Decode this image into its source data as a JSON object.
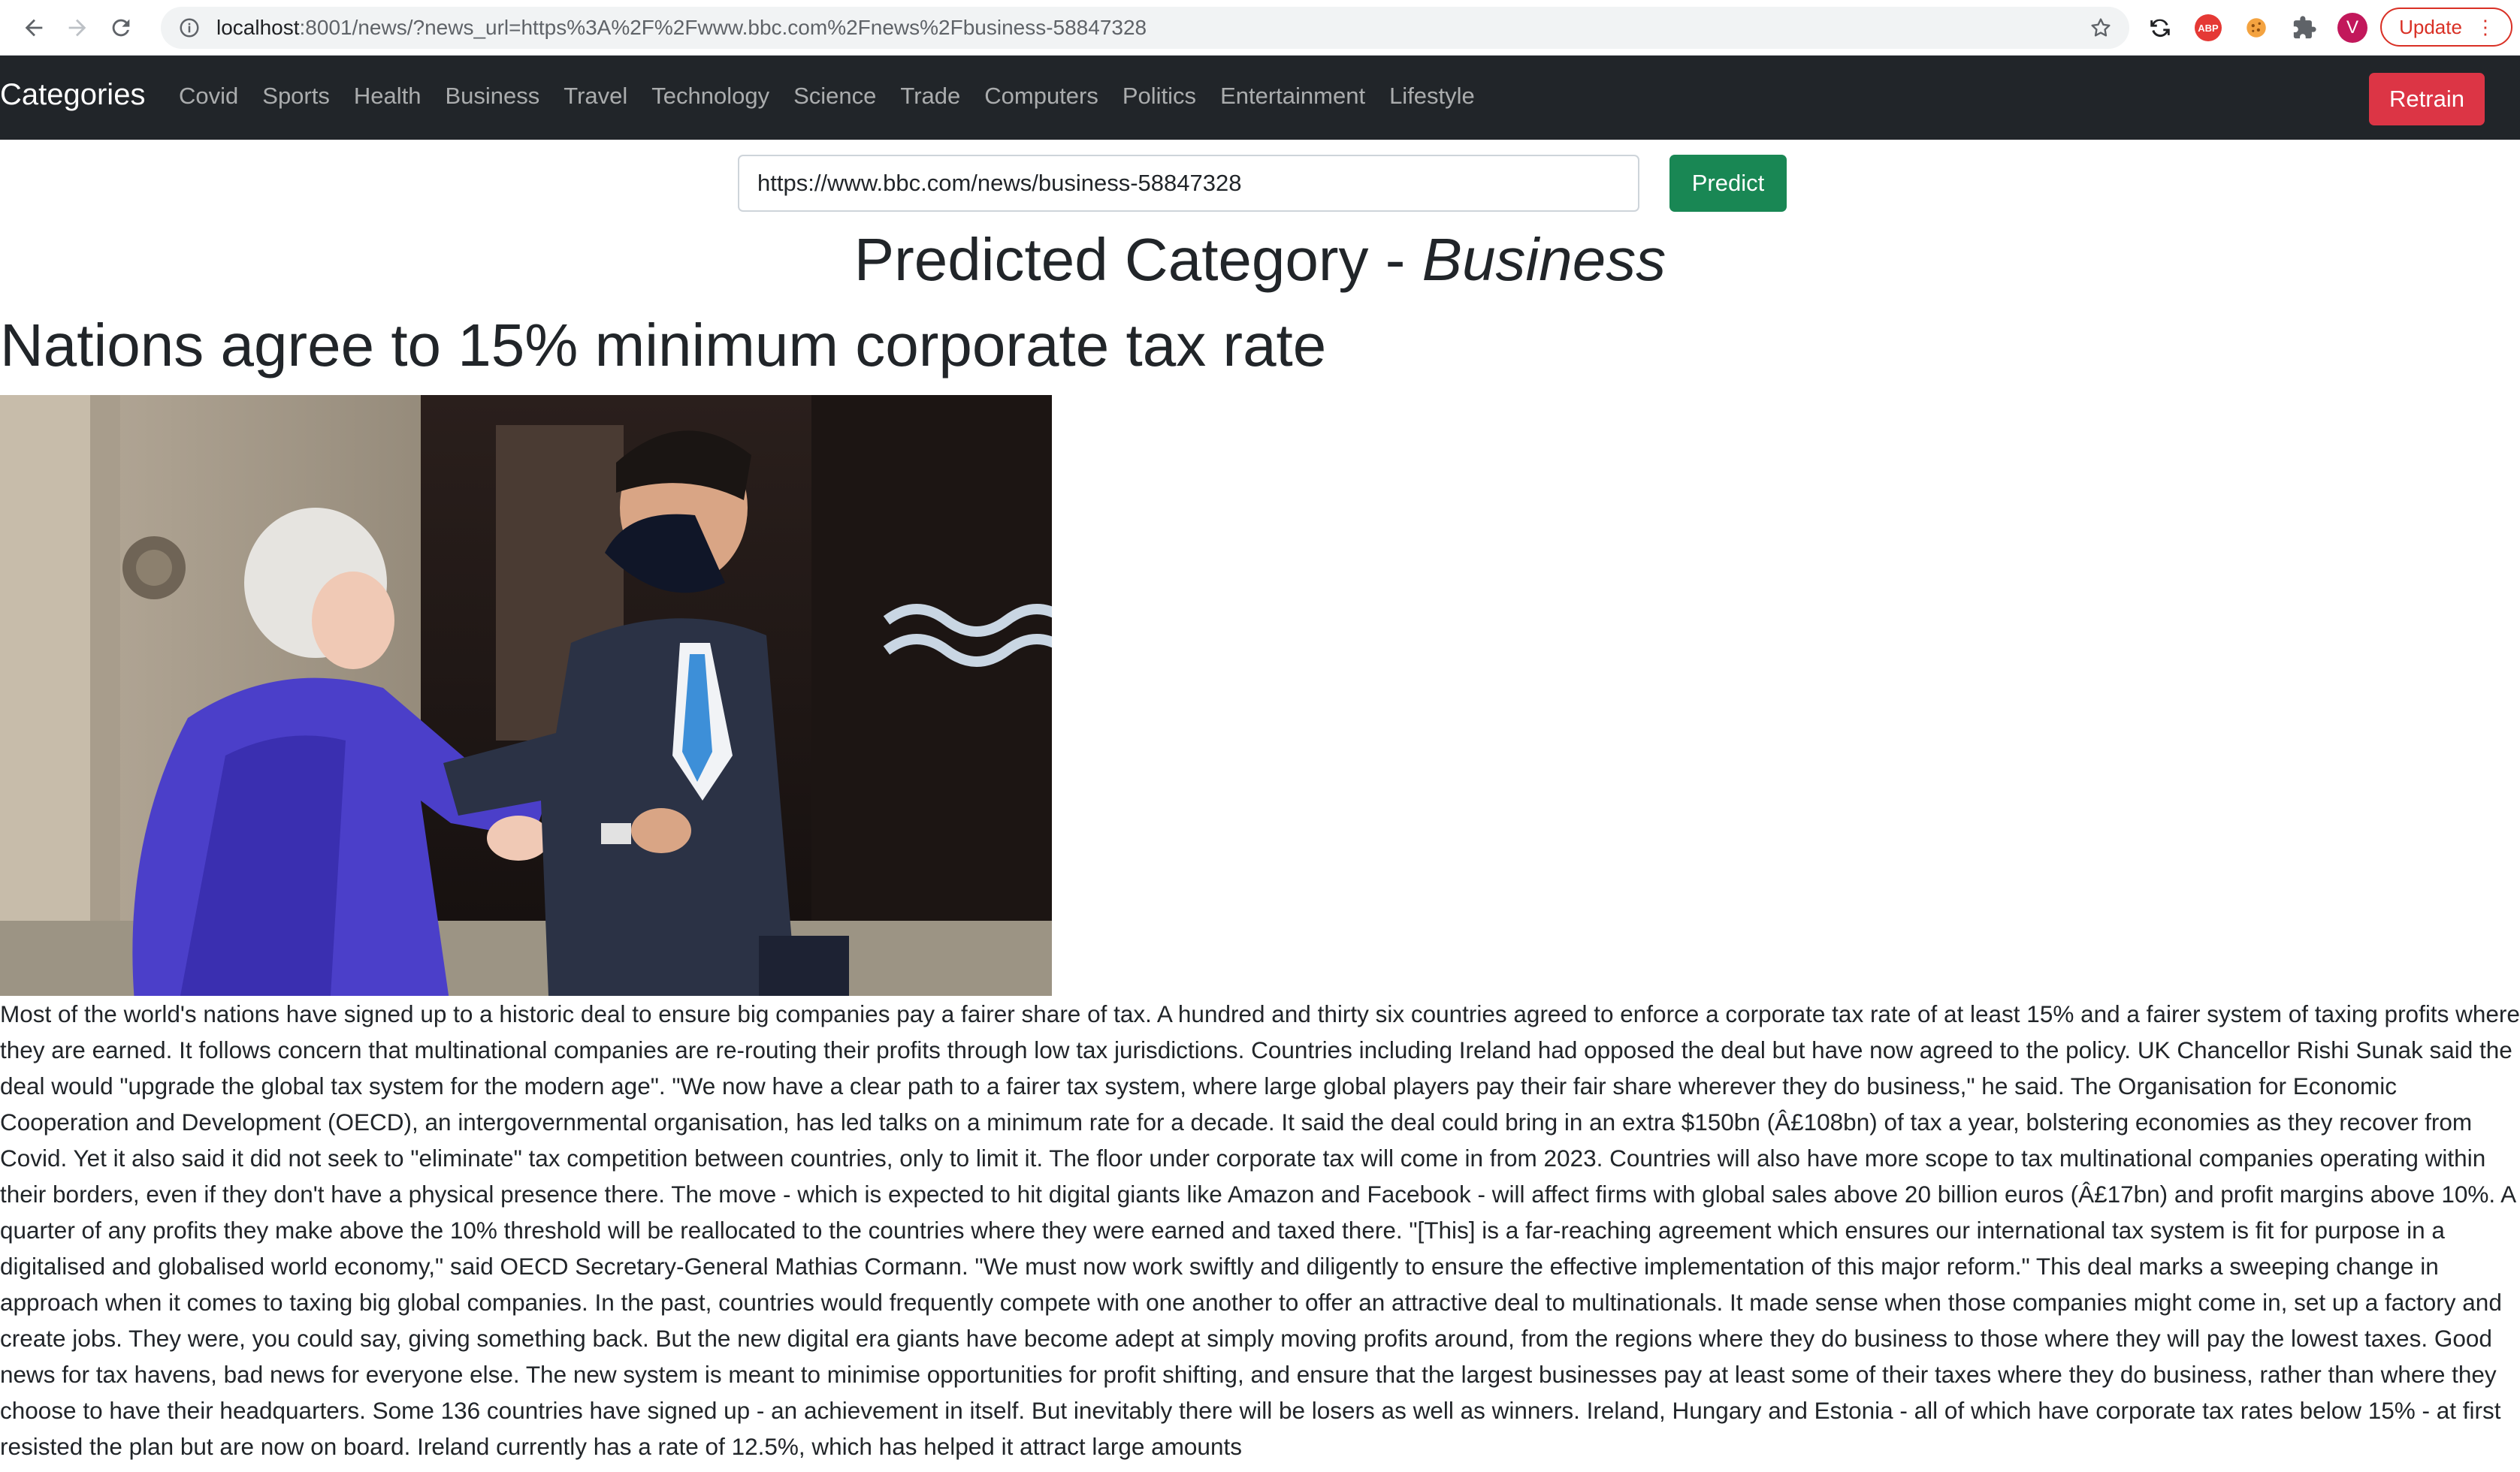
{
  "browser": {
    "url_host": "localhost",
    "url_rest": ":8001/news/?news_url=https%3A%2F%2Fwww.bbc.com%2Fnews%2Fbusiness-58847328",
    "avatar_letter": "V",
    "abp_label": "ABP",
    "update_label": "Update",
    "icons": [
      "back-arrow-icon",
      "forward-arrow-icon",
      "reload-icon",
      "info-icon",
      "star-icon",
      "sync-icon",
      "adblock-icon",
      "cookie-icon",
      "puzzle-icon",
      "kebab-menu-icon"
    ]
  },
  "navbar": {
    "brand": "Categories",
    "links": [
      "Covid",
      "Sports",
      "Health",
      "Business",
      "Travel",
      "Technology",
      "Science",
      "Trade",
      "Computers",
      "Politics",
      "Entertainment",
      "Lifestyle"
    ],
    "retrain_label": "Retrain"
  },
  "form": {
    "url_value": "https://www.bbc.com/news/business-58847328",
    "predict_label": "Predict"
  },
  "prediction": {
    "prefix": "Predicted Category - ",
    "category": "Business"
  },
  "article": {
    "title": "Nations agree to 15% minimum corporate tax rate",
    "body": "Most of the world's nations have signed up to a historic deal to ensure big companies pay a fairer share of tax. A hundred and thirty six countries agreed to enforce a corporate tax rate of at least 15% and a fairer system of taxing profits where they are earned. It follows concern that multinational companies are re-routing their profits through low tax jurisdictions. Countries including Ireland had opposed the deal but have now agreed to the policy. UK Chancellor Rishi Sunak said the deal would \"upgrade the global tax system for the modern age\". \"We now have a clear path to a fairer tax system, where large global players pay their fair share wherever they do business,\" he said. The Organisation for Economic Cooperation and Development (OECD), an intergovernmental organisation, has led talks on a minimum rate for a decade. It said the deal could bring in an extra $150bn (Â£108bn) of tax a year, bolstering economies as they recover from Covid. Yet it also said it did not seek to \"eliminate\" tax competition between countries, only to limit it. The floor under corporate tax will come in from 2023. Countries will also have more scope to tax multinational companies operating within their borders, even if they don't have a physical presence there. The move - which is expected to hit digital giants like Amazon and Facebook - will affect firms with global sales above 20 billion euros (Â£17bn) and profit margins above 10%. A quarter of any profits they make above the 10% threshold will be reallocated to the countries where they were earned and taxed there. \"[This] is a far-reaching agreement which ensures our international tax system is fit for purpose in a digitalised and globalised world economy,\" said OECD Secretary-General Mathias Cormann. \"We must now work swiftly and diligently to ensure the effective implementation of this major reform.\" This deal marks a sweeping change in approach when it comes to taxing big global companies. In the past, countries would frequently compete with one another to offer an attractive deal to multinationals. It made sense when those companies might come in, set up a factory and create jobs. They were, you could say, giving something back. But the new digital era giants have become adept at simply moving profits around, from the regions where they do business to those where they will pay the lowest taxes. Good news for tax havens, bad news for everyone else. The new system is meant to minimise opportunities for profit shifting, and ensure that the largest businesses pay at least some of their taxes where they do business, rather than where they choose to have their headquarters. Some 136 countries have signed up - an achievement in itself. But inevitably there will be losers as well as winners. Ireland, Hungary and Estonia - all of which have corporate tax rates below 15% - at first resisted the plan but are now on board. Ireland currently has a rate of 12.5%, which has helped it attract large amounts"
  },
  "colors": {
    "navbar_bg": "#212529",
    "retrain_red": "#dc3545",
    "predict_green": "#198754",
    "update_red": "#d93025"
  }
}
